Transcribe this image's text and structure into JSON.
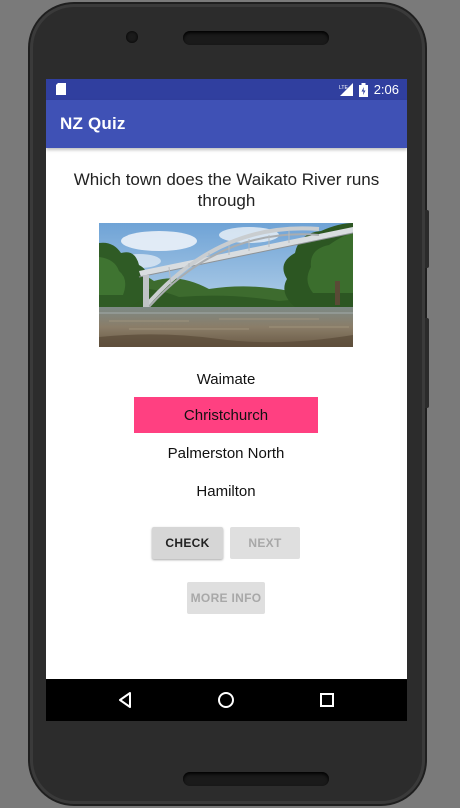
{
  "status_bar": {
    "time": "2:06",
    "icons": [
      "sd-card-icon",
      "signal-lte-icon",
      "battery-icon"
    ]
  },
  "app": {
    "title": "NZ Quiz"
  },
  "quiz": {
    "question": "Which town does the Waikato River runs through",
    "image": "bridge-over-river-photo",
    "options": [
      {
        "label": "Waimate",
        "selected": false
      },
      {
        "label": "Christchurch",
        "selected": true
      },
      {
        "label": "Palmerston North",
        "selected": false
      },
      {
        "label": "Hamilton",
        "selected": false
      }
    ],
    "check_label": "CHECK",
    "next_label": "NEXT",
    "more_info_label": "MORE INFO"
  },
  "colors": {
    "status_bar": "#303f9f",
    "toolbar": "#3f51b5",
    "selected_option": "#ff4081"
  },
  "nav_bar": {
    "icons": [
      "back-icon",
      "home-icon",
      "recents-icon"
    ]
  }
}
